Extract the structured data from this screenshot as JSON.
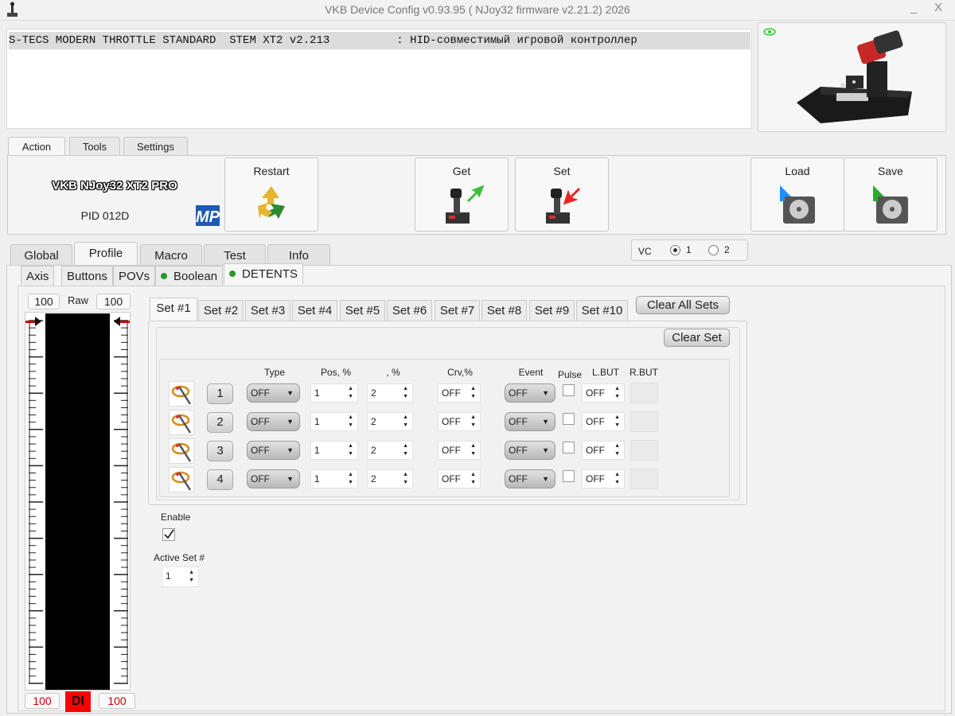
{
  "window": {
    "title": "VKB Device Config v0.93.95 ( NJoy32 firmware v2.21.2) 2026",
    "minimize": "_",
    "close": "X"
  },
  "device": {
    "row_text": "S-TECS MODERN THROTTLE STANDARD  STEM XT2 v2.213          : HID-совместимый игровой контроллер"
  },
  "top_tabs": [
    "Action",
    "Tools",
    "Settings"
  ],
  "action": {
    "model": "VKB NJoy32 XT2 PRO",
    "pid": "PID 012D",
    "logo": "MP",
    "restart": "Restart",
    "get": "Get",
    "set": "Set",
    "load": "Load",
    "save": "Save"
  },
  "main_tabs": [
    "Global",
    "Profile",
    "Macro",
    "Test",
    "Info"
  ],
  "vc": {
    "label": "VC",
    "opt1": "1",
    "opt2": "2",
    "selected": "1"
  },
  "sub_tabs": [
    "Axis",
    "Buttons",
    "POVs",
    "Boolean",
    "DETENTS"
  ],
  "axis": {
    "top_left": "100",
    "raw_label": "Raw",
    "top_right": "100",
    "bottom_left": "100",
    "di": "DI",
    "bottom_right": "100"
  },
  "set_tabs": [
    "Set #1",
    "Set #2",
    "Set #3",
    "Set #4",
    "Set #5",
    "Set #6",
    "Set #7",
    "Set #8",
    "Set #9",
    "Set #10"
  ],
  "clear_all": "Clear All Sets",
  "clear_set": "Clear Set",
  "headers": {
    "type": "Type",
    "pos": "Pos, %",
    "pct": ", %",
    "crv": "Crv,%",
    "event": "Event",
    "pulse": "Pulse",
    "lbut": "L.BUT",
    "rbut": "R.BUT"
  },
  "rows": [
    {
      "num": "1",
      "type": "OFF",
      "pos": "1",
      "pct": "2",
      "crv": "OFF",
      "event": "OFF",
      "lbut": "OFF"
    },
    {
      "num": "2",
      "type": "OFF",
      "pos": "1",
      "pct": "2",
      "crv": "OFF",
      "event": "OFF",
      "lbut": "OFF"
    },
    {
      "num": "3",
      "type": "OFF",
      "pos": "1",
      "pct": "2",
      "crv": "OFF",
      "event": "OFF",
      "lbut": "OFF"
    },
    {
      "num": "4",
      "type": "OFF",
      "pos": "1",
      "pct": "2",
      "crv": "OFF",
      "event": "OFF",
      "lbut": "OFF"
    }
  ],
  "enable": {
    "label": "Enable",
    "checked": true
  },
  "active_set": {
    "label": "Active Set #",
    "value": "1"
  },
  "colors": {
    "bar": "#000000",
    "di": "#ff0000",
    "accent_green": "#2a9a2a",
    "value_red": "#cc0000"
  }
}
